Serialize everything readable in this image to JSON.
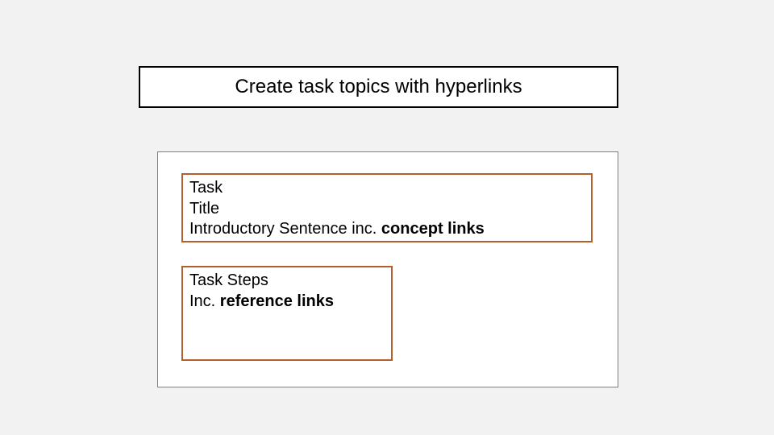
{
  "title": "Create task topics with hyperlinks",
  "intro": {
    "line1": "Task",
    "line2": "Title",
    "line3_prefix": "Introductory Sentence inc. ",
    "line3_bold": "concept links"
  },
  "steps": {
    "line1": "Task Steps",
    "line2_prefix": "Inc. ",
    "line2_bold": "reference links"
  },
  "colors": {
    "accent_border": "#b45f29",
    "background": "#f2f2f2"
  }
}
